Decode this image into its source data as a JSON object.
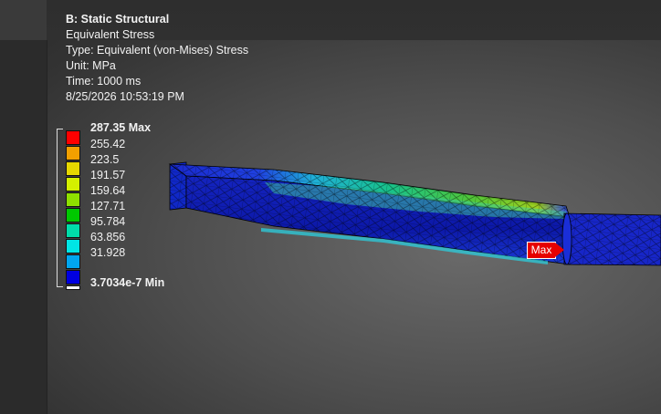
{
  "result": {
    "title": "B: Static Structural",
    "name": "Equivalent Stress",
    "type": "Type: Equivalent (von-Mises) Stress",
    "unit": "Unit: MPa",
    "time": "Time: 1000 ms",
    "timestamp": "8/25/2026 10:53:19 PM"
  },
  "legend": {
    "max_label": "287.35 Max",
    "min_label": "3.7034e-7 Min",
    "levels": [
      "255.42",
      "223.5",
      "191.57",
      "159.64",
      "127.71",
      "95.784",
      "63.856",
      "31.928"
    ],
    "colors": [
      "#ff0000",
      "#f2a000",
      "#e6d800",
      "#d4f000",
      "#8ee000",
      "#00c800",
      "#00dcaa",
      "#00e6e6",
      "#00a6f0",
      "#0000e0"
    ]
  },
  "probe": {
    "label": "Max",
    "color": "#e60000"
  }
}
